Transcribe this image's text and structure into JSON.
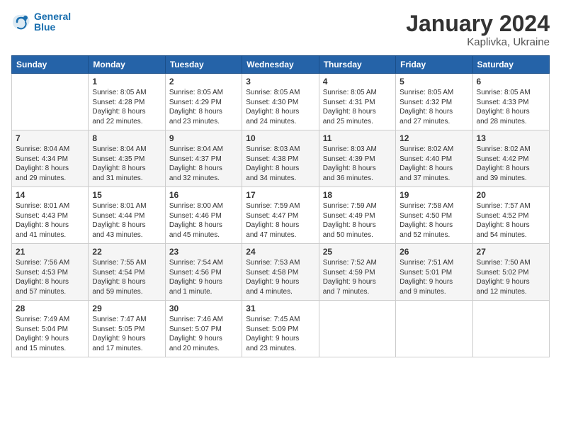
{
  "header": {
    "logo_line1": "General",
    "logo_line2": "Blue",
    "month": "January 2024",
    "location": "Kaplivka, Ukraine"
  },
  "weekdays": [
    "Sunday",
    "Monday",
    "Tuesday",
    "Wednesday",
    "Thursday",
    "Friday",
    "Saturday"
  ],
  "weeks": [
    [
      {
        "day": "",
        "info": ""
      },
      {
        "day": "1",
        "info": "Sunrise: 8:05 AM\nSunset: 4:28 PM\nDaylight: 8 hours\nand 22 minutes."
      },
      {
        "day": "2",
        "info": "Sunrise: 8:05 AM\nSunset: 4:29 PM\nDaylight: 8 hours\nand 23 minutes."
      },
      {
        "day": "3",
        "info": "Sunrise: 8:05 AM\nSunset: 4:30 PM\nDaylight: 8 hours\nand 24 minutes."
      },
      {
        "day": "4",
        "info": "Sunrise: 8:05 AM\nSunset: 4:31 PM\nDaylight: 8 hours\nand 25 minutes."
      },
      {
        "day": "5",
        "info": "Sunrise: 8:05 AM\nSunset: 4:32 PM\nDaylight: 8 hours\nand 27 minutes."
      },
      {
        "day": "6",
        "info": "Sunrise: 8:05 AM\nSunset: 4:33 PM\nDaylight: 8 hours\nand 28 minutes."
      }
    ],
    [
      {
        "day": "7",
        "info": "Sunrise: 8:04 AM\nSunset: 4:34 PM\nDaylight: 8 hours\nand 29 minutes."
      },
      {
        "day": "8",
        "info": "Sunrise: 8:04 AM\nSunset: 4:35 PM\nDaylight: 8 hours\nand 31 minutes."
      },
      {
        "day": "9",
        "info": "Sunrise: 8:04 AM\nSunset: 4:37 PM\nDaylight: 8 hours\nand 32 minutes."
      },
      {
        "day": "10",
        "info": "Sunrise: 8:03 AM\nSunset: 4:38 PM\nDaylight: 8 hours\nand 34 minutes."
      },
      {
        "day": "11",
        "info": "Sunrise: 8:03 AM\nSunset: 4:39 PM\nDaylight: 8 hours\nand 36 minutes."
      },
      {
        "day": "12",
        "info": "Sunrise: 8:02 AM\nSunset: 4:40 PM\nDaylight: 8 hours\nand 37 minutes."
      },
      {
        "day": "13",
        "info": "Sunrise: 8:02 AM\nSunset: 4:42 PM\nDaylight: 8 hours\nand 39 minutes."
      }
    ],
    [
      {
        "day": "14",
        "info": "Sunrise: 8:01 AM\nSunset: 4:43 PM\nDaylight: 8 hours\nand 41 minutes."
      },
      {
        "day": "15",
        "info": "Sunrise: 8:01 AM\nSunset: 4:44 PM\nDaylight: 8 hours\nand 43 minutes."
      },
      {
        "day": "16",
        "info": "Sunrise: 8:00 AM\nSunset: 4:46 PM\nDaylight: 8 hours\nand 45 minutes."
      },
      {
        "day": "17",
        "info": "Sunrise: 7:59 AM\nSunset: 4:47 PM\nDaylight: 8 hours\nand 47 minutes."
      },
      {
        "day": "18",
        "info": "Sunrise: 7:59 AM\nSunset: 4:49 PM\nDaylight: 8 hours\nand 50 minutes."
      },
      {
        "day": "19",
        "info": "Sunrise: 7:58 AM\nSunset: 4:50 PM\nDaylight: 8 hours\nand 52 minutes."
      },
      {
        "day": "20",
        "info": "Sunrise: 7:57 AM\nSunset: 4:52 PM\nDaylight: 8 hours\nand 54 minutes."
      }
    ],
    [
      {
        "day": "21",
        "info": "Sunrise: 7:56 AM\nSunset: 4:53 PM\nDaylight: 8 hours\nand 57 minutes."
      },
      {
        "day": "22",
        "info": "Sunrise: 7:55 AM\nSunset: 4:54 PM\nDaylight: 8 hours\nand 59 minutes."
      },
      {
        "day": "23",
        "info": "Sunrise: 7:54 AM\nSunset: 4:56 PM\nDaylight: 9 hours\nand 1 minute."
      },
      {
        "day": "24",
        "info": "Sunrise: 7:53 AM\nSunset: 4:58 PM\nDaylight: 9 hours\nand 4 minutes."
      },
      {
        "day": "25",
        "info": "Sunrise: 7:52 AM\nSunset: 4:59 PM\nDaylight: 9 hours\nand 7 minutes."
      },
      {
        "day": "26",
        "info": "Sunrise: 7:51 AM\nSunset: 5:01 PM\nDaylight: 9 hours\nand 9 minutes."
      },
      {
        "day": "27",
        "info": "Sunrise: 7:50 AM\nSunset: 5:02 PM\nDaylight: 9 hours\nand 12 minutes."
      }
    ],
    [
      {
        "day": "28",
        "info": "Sunrise: 7:49 AM\nSunset: 5:04 PM\nDaylight: 9 hours\nand 15 minutes."
      },
      {
        "day": "29",
        "info": "Sunrise: 7:47 AM\nSunset: 5:05 PM\nDaylight: 9 hours\nand 17 minutes."
      },
      {
        "day": "30",
        "info": "Sunrise: 7:46 AM\nSunset: 5:07 PM\nDaylight: 9 hours\nand 20 minutes."
      },
      {
        "day": "31",
        "info": "Sunrise: 7:45 AM\nSunset: 5:09 PM\nDaylight: 9 hours\nand 23 minutes."
      },
      {
        "day": "",
        "info": ""
      },
      {
        "day": "",
        "info": ""
      },
      {
        "day": "",
        "info": ""
      }
    ]
  ]
}
